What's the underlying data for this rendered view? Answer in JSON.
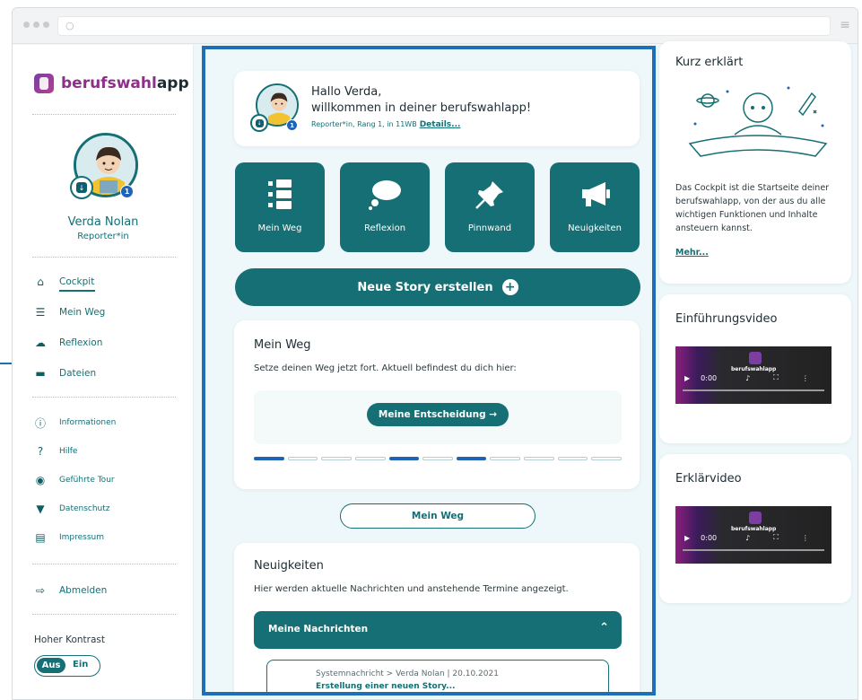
{
  "sidebar": {
    "logo_part1": "berufswahl",
    "logo_part2": "app",
    "user_name": "Verda Nolan",
    "user_role": "Reporter*in",
    "badge_number": "1",
    "nav_main": [
      {
        "label": "Cockpit",
        "icon": "home-icon"
      },
      {
        "label": "Mein Weg",
        "icon": "path-icon"
      },
      {
        "label": "Reflexion",
        "icon": "thought-icon"
      },
      {
        "label": "Dateien",
        "icon": "folder-icon"
      }
    ],
    "nav_info": [
      {
        "label": "Informationen",
        "icon": "info-icon"
      },
      {
        "label": "Hilfe",
        "icon": "help-icon"
      },
      {
        "label": "Geführte Tour",
        "icon": "compass-icon"
      },
      {
        "label": "Datenschutz",
        "icon": "shield-icon"
      },
      {
        "label": "Impressum",
        "icon": "book-icon"
      }
    ],
    "logout_label": "Abmelden",
    "contrast_label": "Hoher Kontrast",
    "contrast_off": "Aus",
    "contrast_on": "Ein"
  },
  "greeting": {
    "line1": "Hallo Verda,",
    "line2": "willkommen in deiner berufswahlapp!",
    "meta": "Reporter*in, Rang 1, in 11WB",
    "details_link": "Details..."
  },
  "tiles": [
    {
      "label": "Mein Weg",
      "icon": "path-icon"
    },
    {
      "label": "Reflexion",
      "icon": "thought-icon"
    },
    {
      "label": "Pinnwand",
      "icon": "pin-icon"
    },
    {
      "label": "Neuigkeiten",
      "icon": "megaphone-icon"
    }
  ],
  "story_button": "Neue Story erstellen",
  "mein_weg": {
    "title": "Mein Weg",
    "text": "Setze deinen Weg jetzt fort. Aktuell befindest du dich hier:",
    "step_button": "Meine Entscheidung →",
    "progress_segments": [
      true,
      false,
      false,
      false,
      true,
      false,
      true,
      false,
      false,
      false,
      false
    ],
    "link_button": "Mein Weg"
  },
  "neuigkeiten": {
    "title": "Neuigkeiten",
    "text": "Hier werden aktuelle Nachrichten und anstehende Termine angezeigt.",
    "accordion_label": "Meine Nachrichten",
    "message_meta": "Systemnachricht > Verda Nolan | 20.10.2021",
    "message_title": "Erstellung einer neuen Story..."
  },
  "kurz": {
    "title": "Kurz erklärt",
    "text": "Das Cockpit ist die Startseite deiner berufswahlapp, von der aus du alle wichtigen Funktionen und Inhalte ansteuern kannst.",
    "more_link": "Mehr..."
  },
  "videos": [
    {
      "title": "Einführungsvideo",
      "time": "0:00",
      "brand": "berufswahlapp"
    },
    {
      "title": "Erklärvideo",
      "time": "0:00",
      "brand": "berufswahlapp"
    }
  ],
  "colors": {
    "primary": "#156f74",
    "accent": "#1f63b8",
    "frame": "#1f6fb7"
  }
}
